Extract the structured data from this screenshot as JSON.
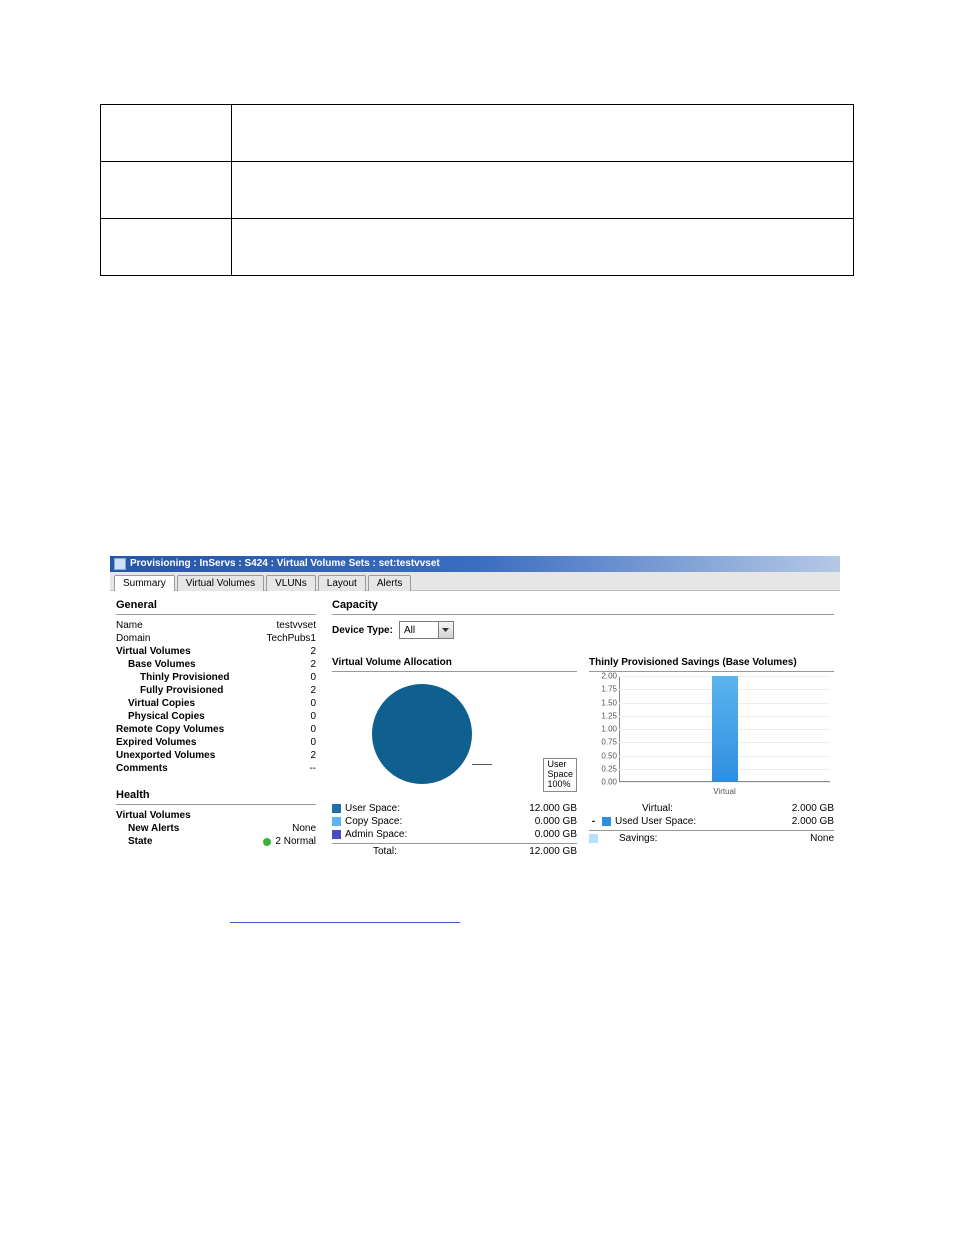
{
  "window_title": "Provisioning : InServs : S424 : Virtual Volume Sets : set:testvvset",
  "tabs": [
    "Summary",
    "Virtual Volumes",
    "VLUNs",
    "Layout",
    "Alerts"
  ],
  "active_tab": 0,
  "general": {
    "heading": "General",
    "rows": [
      {
        "k": "Name",
        "v": "testvvset",
        "bold": false,
        "indent": 0
      },
      {
        "k": "Domain",
        "v": "TechPubs1",
        "bold": false,
        "indent": 0
      },
      {
        "k": "Virtual Volumes",
        "v": "2",
        "bold": true,
        "indent": 0
      },
      {
        "k": "Base Volumes",
        "v": "2",
        "bold": true,
        "indent": 1
      },
      {
        "k": "Thinly Provisioned",
        "v": "0",
        "bold": true,
        "indent": 2
      },
      {
        "k": "Fully Provisioned",
        "v": "2",
        "bold": true,
        "indent": 2
      },
      {
        "k": "Virtual Copies",
        "v": "0",
        "bold": true,
        "indent": 1
      },
      {
        "k": "Physical Copies",
        "v": "0",
        "bold": true,
        "indent": 1
      },
      {
        "k": "Remote Copy Volumes",
        "v": "0",
        "bold": true,
        "indent": 0
      },
      {
        "k": "Expired Volumes",
        "v": "0",
        "bold": true,
        "indent": 0
      },
      {
        "k": "Unexported Volumes",
        "v": "2",
        "bold": true,
        "indent": 0
      },
      {
        "k": "Comments",
        "v": "--",
        "bold": true,
        "indent": 0
      }
    ]
  },
  "health": {
    "heading": "Health",
    "sub_heading": "Virtual Volumes",
    "new_alerts_label": "New Alerts",
    "new_alerts_value": "None",
    "state_label": "State",
    "state_value": "2 Normal"
  },
  "capacity": {
    "heading": "Capacity",
    "device_type_label": "Device Type:",
    "device_type_value": "All",
    "allocation_heading": "Virtual Volume Allocation",
    "savings_heading": "Thinly Provisioned Savings (Base Volumes)",
    "pie_callout_lines": [
      "User",
      "Space",
      "100%"
    ],
    "alloc_rows": [
      {
        "label": "User Space:",
        "value": "12.000 GB",
        "color": "#1f6fa8"
      },
      {
        "label": "Copy Space:",
        "value": "0.000 GB",
        "color": "#5bb4ee"
      },
      {
        "label": "Admin Space:",
        "value": "0.000 GB",
        "color": "#4a4ac2"
      }
    ],
    "alloc_total_label": "Total:",
    "alloc_total_value": "12.000 GB",
    "savings_rows": [
      {
        "label": "Virtual:",
        "value": "2.000 GB",
        "swatch": null,
        "dash": false
      },
      {
        "label": "Used User Space:",
        "value": "2.000 GB",
        "swatch": "#2f8fe0",
        "dash": true
      }
    ],
    "savings_footer_label": "Savings:",
    "savings_footer_value": "None",
    "savings_footer_swatch": "#b8dffb"
  },
  "chart_data": {
    "type": "bar",
    "categories": [
      "Virtual"
    ],
    "values": [
      2.0
    ],
    "title": "Thinly Provisioned Savings (Base Volumes)",
    "xlabel": "",
    "ylabel": "",
    "ylim": [
      0,
      2
    ],
    "yticks": [
      0.0,
      0.25,
      0.5,
      0.75,
      1.0,
      1.25,
      1.5,
      1.75,
      2.0
    ]
  }
}
